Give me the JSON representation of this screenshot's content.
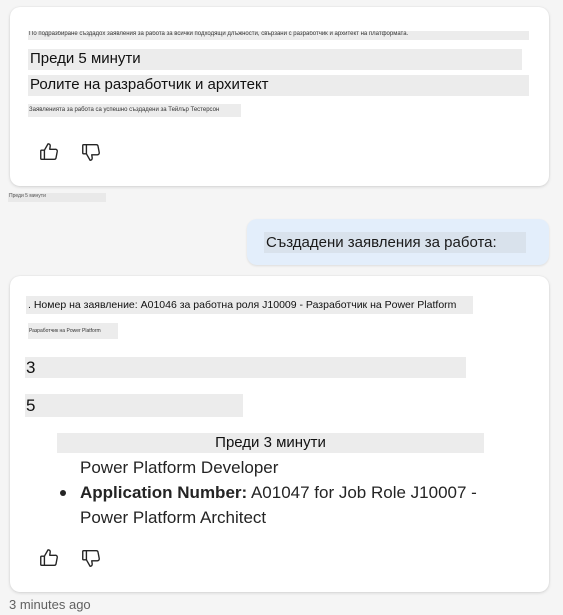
{
  "card1": {
    "tiny_line": "По подразбиране създадох заявления за работа за всички подходящи длъжности, свързани с разработчик и архитект на платформата.",
    "time_label": "Преди 5 минути",
    "roles_heading": "Ролите на разработчик и архитект",
    "status_line": "Заявленията за работа са успешно създадени за Тейлър Тестерсон",
    "like_icon": "thumbs-up-icon",
    "dislike_icon": "thumbs-down-icon"
  },
  "first_timestamp": "Преди 5 минути",
  "user_message": "Създадени заявления за работа:",
  "card2": {
    "application_line": ". Номер на заявление: A01046 за работна роля J10009 - Разработчик на Power Platform",
    "tiny_line": "Разработчик на Power Platform",
    "num_a": "3",
    "num_b": "5",
    "time_label": "Преди 3 минути",
    "continued_text": "Power Platform Developer",
    "bullet_label": "Application Number:",
    "bullet_value": " A01047 for Job Role J10007 -",
    "bullet_value_cont": "Power Platform Architect",
    "like_icon": "thumbs-up-icon",
    "dislike_icon": "thumbs-down-icon"
  },
  "footer_timestamp": "3 minutes ago"
}
